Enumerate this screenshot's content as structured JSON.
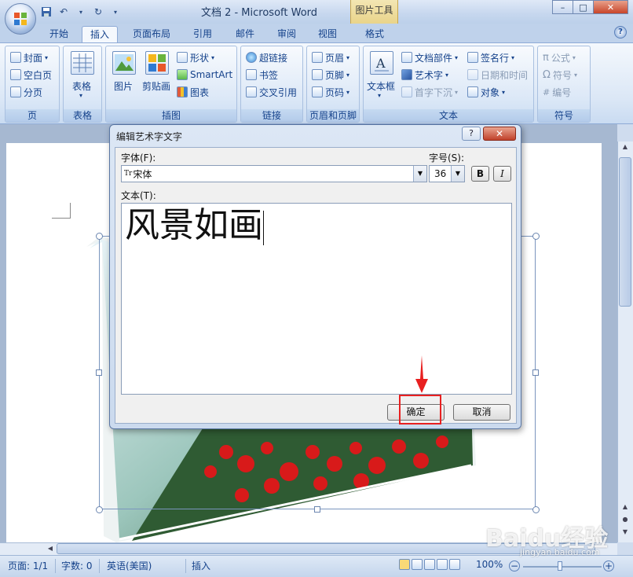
{
  "window": {
    "title": "文档 2 - Microsoft Word",
    "context_tab_title": "图片工具",
    "controls": {
      "minimize": "–",
      "maximize": "□",
      "close": "✕"
    }
  },
  "quick_access": {
    "save_icon": "save-icon",
    "undo_icon": "undo-icon",
    "redo_icon": "redo-icon",
    "more": "▾"
  },
  "tabs": [
    "开始",
    "插入",
    "页面布局",
    "引用",
    "邮件",
    "审阅",
    "视图",
    "格式"
  ],
  "active_tab": "插入",
  "ribbon": {
    "pages": {
      "title": "页",
      "items": [
        "封面",
        "空白页",
        "分页"
      ]
    },
    "tables": {
      "title": "表格",
      "items": [
        "表格"
      ]
    },
    "illustrations": {
      "title": "插图",
      "items": [
        "图片",
        "剪贴画",
        "形状",
        "SmartArt",
        "图表"
      ]
    },
    "links": {
      "title": "链接",
      "items": [
        "超链接",
        "书签",
        "交叉引用"
      ]
    },
    "header_footer": {
      "title": "页眉和页脚",
      "items": [
        "页眉",
        "页脚",
        "页码"
      ]
    },
    "text": {
      "title": "文本",
      "items": [
        "文本框",
        "文档部件",
        "艺术字",
        "首字下沉",
        "签名行",
        "日期和时间",
        "对象"
      ]
    },
    "symbols": {
      "title": "符号",
      "items": [
        "公式",
        "符号",
        "编号"
      ]
    }
  },
  "dialog": {
    "title": "编辑艺术字文字",
    "help": "?",
    "close": "✕",
    "font_label": "字体(F):",
    "font_value": "宋体",
    "font_prefix": "Tr",
    "size_label": "字号(S):",
    "size_value": "36",
    "bold": "B",
    "italic": "I",
    "text_label": "文本(T):",
    "text_value": "风景如画",
    "ok": "确定",
    "cancel": "取消"
  },
  "statusbar": {
    "page": "页面: 1/1",
    "words": "字数: 0",
    "language": "英语(美国)",
    "mode": "插入",
    "zoom": "100%"
  },
  "watermark": {
    "main": "Baidu经验",
    "sub": "jingyan.baidu.com"
  },
  "colors": {
    "accent": "#15428b",
    "highlight": "#e82020",
    "ribbon_bg": "#dbe7f6"
  }
}
